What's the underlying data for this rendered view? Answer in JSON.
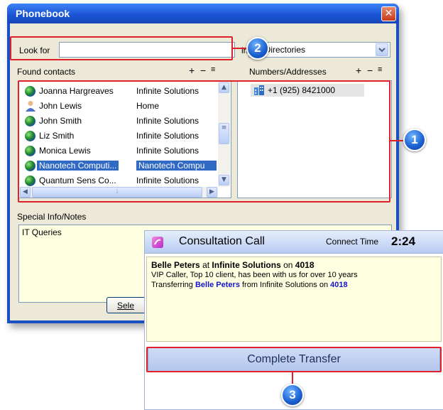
{
  "window": {
    "title": "Phonebook",
    "close_glyph": "✕"
  },
  "search": {
    "label": "Look for",
    "value": "",
    "in_label": "in",
    "directory": "All Directories"
  },
  "contacts": {
    "header": "Found contacts",
    "tools": [
      "+",
      "−",
      "≡"
    ],
    "rows": [
      {
        "name": "Joanna Hargreaves",
        "company": "Infinite Solutions",
        "icon": "globe-icon"
      },
      {
        "name": "John Lewis",
        "company": "Home",
        "icon": "person-icon"
      },
      {
        "name": "John Smith",
        "company": "Infinite Solutions",
        "icon": "globe-icon"
      },
      {
        "name": "Liz Smith",
        "company": "Infinite Solutions",
        "icon": "globe-icon"
      },
      {
        "name": "Monica Lewis",
        "company": "Infinite Solutions",
        "icon": "globe-icon"
      },
      {
        "name": "Nanotech Computi...",
        "company": "Nanotech Compu",
        "icon": "globe-icon"
      },
      {
        "name": "Quantum Sens Co...",
        "company": "Infinite Solutions",
        "icon": "globe-icon"
      }
    ]
  },
  "numbers": {
    "header": "Numbers/Addresses",
    "tools": [
      "+",
      "−",
      "≡"
    ],
    "items": [
      {
        "value": "+1 (925) 8421000",
        "icon": "building-icon"
      }
    ]
  },
  "notes": {
    "label": "Special Info/Notes",
    "text": "IT Queries"
  },
  "select_button": "Sele",
  "consult": {
    "title": "Consultation Call",
    "connect_label": "Connect Time",
    "connect_time": "2:24",
    "line1": {
      "name": "Belle Peters",
      "at": "at",
      "company": "Infinite Solutions",
      "on": "on",
      "ext": "4018"
    },
    "line2": "VIP Caller, Top 10 client, has been with us for over 10 years",
    "line3": {
      "prefix": "Transferring",
      "name": "Belle Peters",
      "mid": "from Infinite Solutions on",
      "ext": "4018"
    },
    "button": "Complete Transfer"
  },
  "callouts": [
    "1",
    "2",
    "3"
  ],
  "colors": {
    "callout_red": "#e0202b",
    "accent_blue": "#1a4fc4",
    "notes_bg": "#ffffe1"
  }
}
